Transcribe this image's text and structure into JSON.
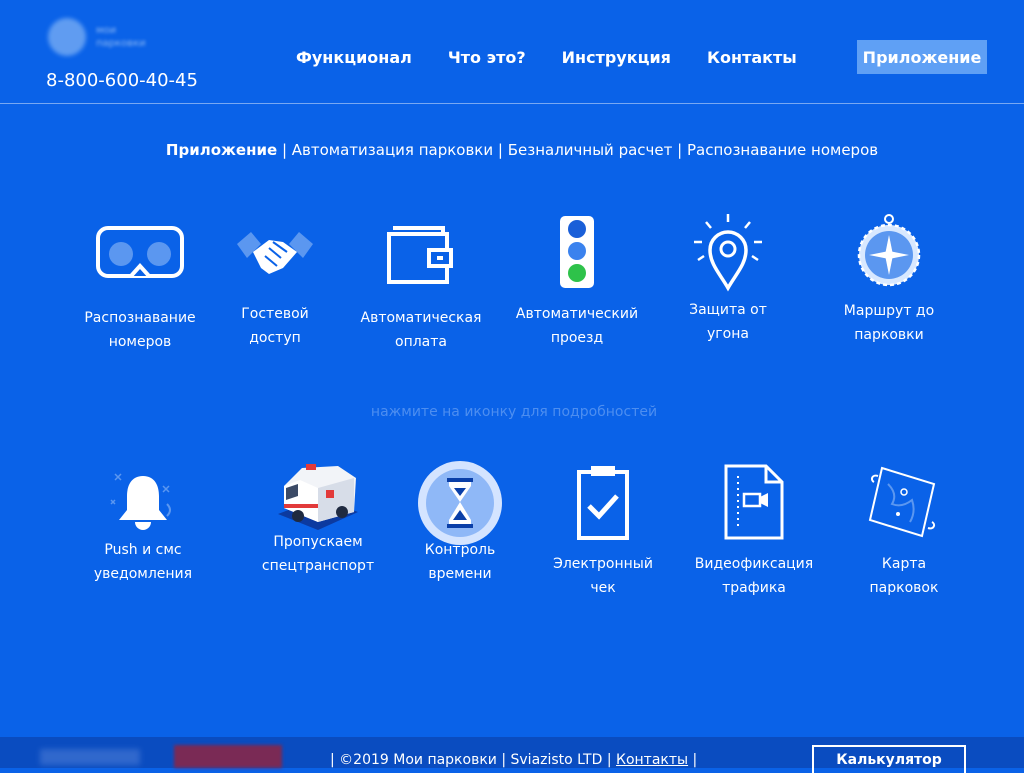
{
  "header": {
    "phone": "8-800-600-40-45",
    "nav": [
      "Функционал",
      "Что это?",
      "Инструкция",
      "Контакты"
    ],
    "app_button": "Приложение"
  },
  "subnav": {
    "active": "Приложение",
    "items": [
      "Автоматизация парковки",
      "Безналичный расчет",
      "Распознавание номеров"
    ]
  },
  "features_row1": [
    {
      "line1": "Распознавание",
      "line2": "номеров",
      "icon": "vr-glasses-icon"
    },
    {
      "line1": "Гостевой",
      "line2": "доступ",
      "icon": "handshake-icon"
    },
    {
      "line1": "Автоматическая",
      "line2": "оплата",
      "icon": "wallet-icon"
    },
    {
      "line1": "Автоматический",
      "line2": "проезд",
      "icon": "traffic-light-icon"
    },
    {
      "line1": "Защита от",
      "line2": "угона",
      "icon": "location-pin-icon"
    },
    {
      "line1": "Маршрут до",
      "line2": "парковки",
      "icon": "compass-icon"
    }
  ],
  "hint": "нажмите на иконку для подробностей",
  "features_row2": [
    {
      "line1": "Push и смс",
      "line2": "уведомления",
      "icon": "bell-icon"
    },
    {
      "line1": "Пропускаем",
      "line2": "спецтранспорт",
      "icon": "ambulance-icon"
    },
    {
      "line1": "Контроль",
      "line2": "времени",
      "icon": "hourglass-icon"
    },
    {
      "line1": "Электронный",
      "line2": "чек",
      "icon": "clipboard-check-icon"
    },
    {
      "line1": "Видеофиксация",
      "line2": "трафика",
      "icon": "video-file-icon"
    },
    {
      "line1": "Карта",
      "line2": "парковок",
      "icon": "map-scroll-icon"
    }
  ],
  "footer": {
    "text_prefix": "| ©2019 Мои парковки | Sviazisto LTD |",
    "contacts": "Контакты",
    "text_suffix": "|",
    "calculator": "Калькулятор"
  }
}
